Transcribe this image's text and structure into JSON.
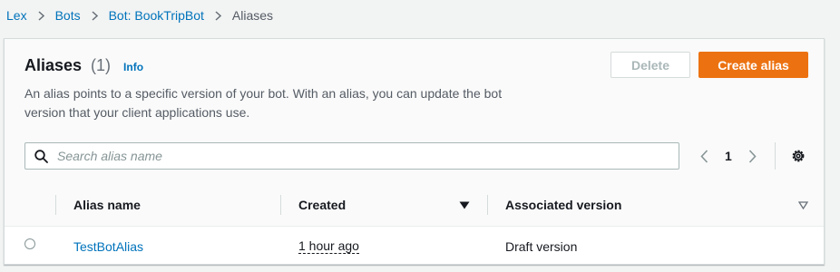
{
  "breadcrumb": {
    "items": [
      "Lex",
      "Bots",
      "Bot: BookTripBot"
    ],
    "current": "Aliases"
  },
  "panel": {
    "title": "Aliases",
    "count": "(1)",
    "info": "Info",
    "description": "An alias points to a specific version of your bot. With an alias, you can update the bot version that your client applications use.",
    "delete_label": "Delete",
    "create_label": "Create alias"
  },
  "search": {
    "placeholder": "Search alias name",
    "value": ""
  },
  "pagination": {
    "current_page": "1"
  },
  "table": {
    "columns": [
      "Alias name",
      "Created",
      "Associated version"
    ],
    "rows": [
      {
        "alias_name": "TestBotAlias",
        "created": "1 hour ago",
        "version": "Draft version"
      }
    ]
  },
  "colors": {
    "accent": "#ec7211",
    "link": "#0073bb"
  },
  "icons": {
    "breadcrumb_separator": "chevron-right-icon",
    "search": "search-icon",
    "prev": "chevron-left-icon",
    "next": "chevron-right-icon",
    "settings": "gear-icon",
    "sort_active": "caret-down-filled-icon",
    "sort_inactive": "caret-down-outline-icon"
  }
}
